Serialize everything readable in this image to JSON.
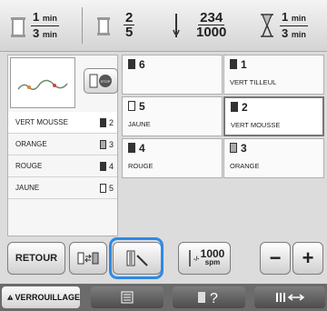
{
  "topbar": {
    "elapsed": {
      "num": "1",
      "den": "3",
      "unit": "min"
    },
    "color_counter": {
      "num": "2",
      "den": "5"
    },
    "stitches": {
      "num": "234",
      "den": "1000"
    },
    "remaining": {
      "num": "1",
      "den": "3",
      "unit": "min"
    }
  },
  "thread_list": [
    {
      "name": "VERT MOUSSE",
      "index": "2",
      "spool": "filled"
    },
    {
      "name": "ORANGE",
      "index": "3",
      "spool": "light"
    },
    {
      "name": "ROUGE",
      "index": "4",
      "spool": "filled"
    },
    {
      "name": "JAUNE",
      "index": "5",
      "spool": "empty"
    }
  ],
  "grid": [
    {
      "num": "6",
      "name": "",
      "spool": "filled"
    },
    {
      "num": "1",
      "name": "VERT TILLEUL",
      "spool": "filled"
    },
    {
      "num": "5",
      "name": "JAUNE",
      "spool": "empty"
    },
    {
      "num": "2",
      "name": "VERT MOUSSE",
      "spool": "filled",
      "selected": true
    },
    {
      "num": "4",
      "name": "ROUGE",
      "spool": "filled"
    },
    {
      "num": "3",
      "name": "ORANGE",
      "spool": "light"
    }
  ],
  "buttons": {
    "back": "RETOUR",
    "speed": "1000",
    "speed_unit": "spm",
    "minus": "−",
    "plus": "+"
  },
  "footer": {
    "lock": "VERROUILLAGE"
  },
  "colors": {
    "focus": "#2c8ae8",
    "footer_bg": "#6b6b6b"
  }
}
